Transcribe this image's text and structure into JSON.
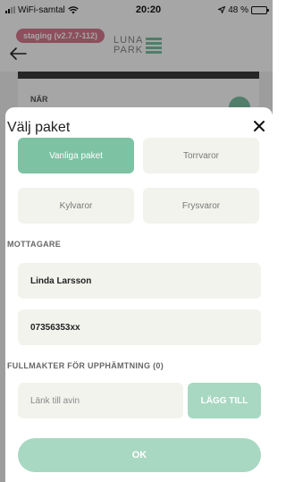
{
  "status_bar": {
    "carrier": "WiFi-samtal",
    "time": "20:20",
    "battery": "48 %",
    "battery_level": 0.48
  },
  "header": {
    "staging_badge": "staging (v2.7.7-112)",
    "logo_line1": "LUNA",
    "logo_line2": "PARK"
  },
  "background": {
    "card_label": "NÄR"
  },
  "sheet": {
    "title": "Välj paket",
    "packages": [
      {
        "label": "Vanliga paket",
        "active": true
      },
      {
        "label": "Torrvaror",
        "active": false
      },
      {
        "label": "Kylvaror",
        "active": false
      },
      {
        "label": "Frysvaror",
        "active": false
      }
    ],
    "recipient_label": "MOTTAGARE",
    "recipient_name": "Linda Larsson",
    "recipient_phone": "07356353xx",
    "proxy_label": "FULLMAKTER FÖR UPPHÄMTNING (0)",
    "proxy_placeholder": "Länk till avin",
    "add_button": "LÄGG TILL",
    "ok_button": "OK"
  },
  "colors": {
    "accent": "#7cc2a3",
    "accent_light": "#a8d8c2",
    "field_bg": "#f3f3ee",
    "badge": "#d97a8e"
  },
  "icons": {
    "back": "back-arrow-icon",
    "close": "close-icon",
    "wifi": "wifi-icon",
    "signal": "signal-icon",
    "battery": "battery-icon",
    "location": "location-arrow-icon"
  }
}
